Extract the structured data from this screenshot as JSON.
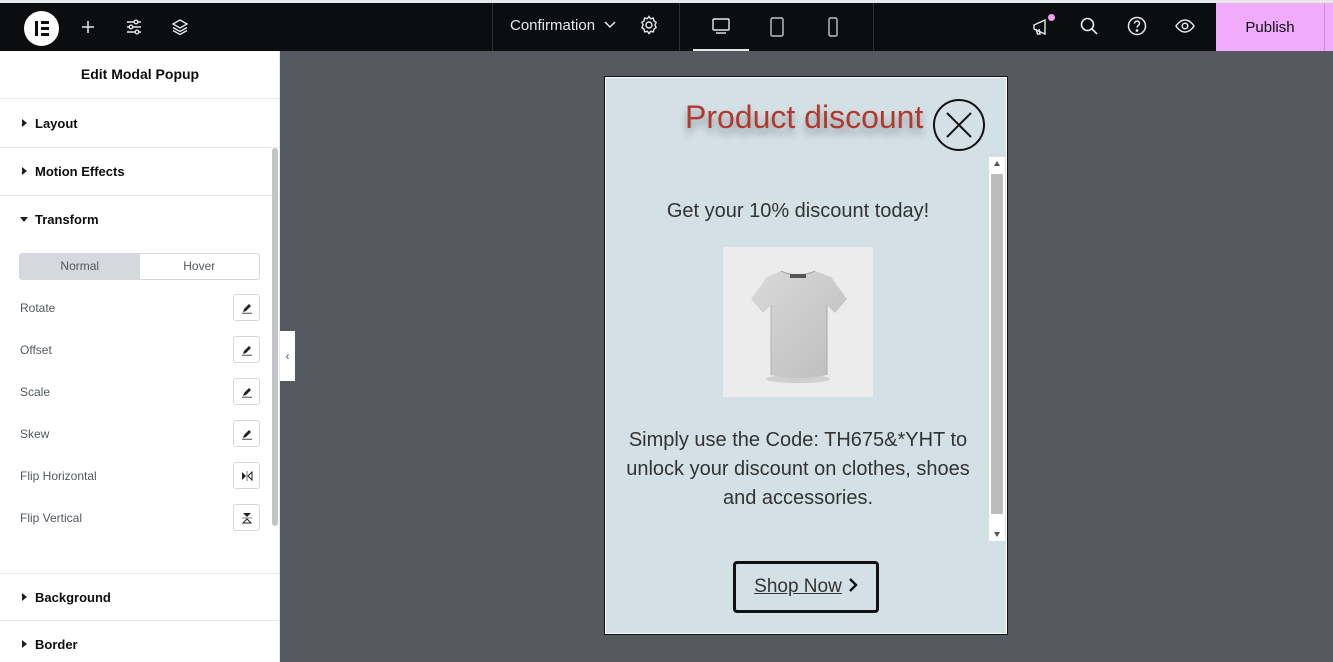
{
  "topbar": {
    "document_title": "Confirmation",
    "publish_label": "Publish",
    "active_device": "desktop"
  },
  "panel": {
    "title": "Edit Modal Popup",
    "sections": {
      "layout": "Layout",
      "motion": "Motion Effects",
      "transform": "Transform",
      "background": "Background",
      "border": "Border"
    },
    "tabs": {
      "normal": "Normal",
      "hover": "Hover",
      "active": "Normal"
    },
    "controls": {
      "rotate": "Rotate",
      "offset": "Offset",
      "scale": "Scale",
      "skew": "Skew",
      "flip_horizontal": "Flip Horizontal",
      "flip_vertical": "Flip Vertical"
    }
  },
  "popup": {
    "title": "Product discount",
    "headline": "Get your 10% discount today!",
    "body": "Simply use the Code: TH675&*YHT to unlock your discount on clothes, shoes and accessories.",
    "button_label": "Shop Now"
  },
  "colors": {
    "topbar_bg": "#0c0d0e",
    "publish_bg": "#f0abfc",
    "canvas_bg": "#555960",
    "popup_bg": "#d3e0e6",
    "popup_title": "#b03a2e"
  }
}
